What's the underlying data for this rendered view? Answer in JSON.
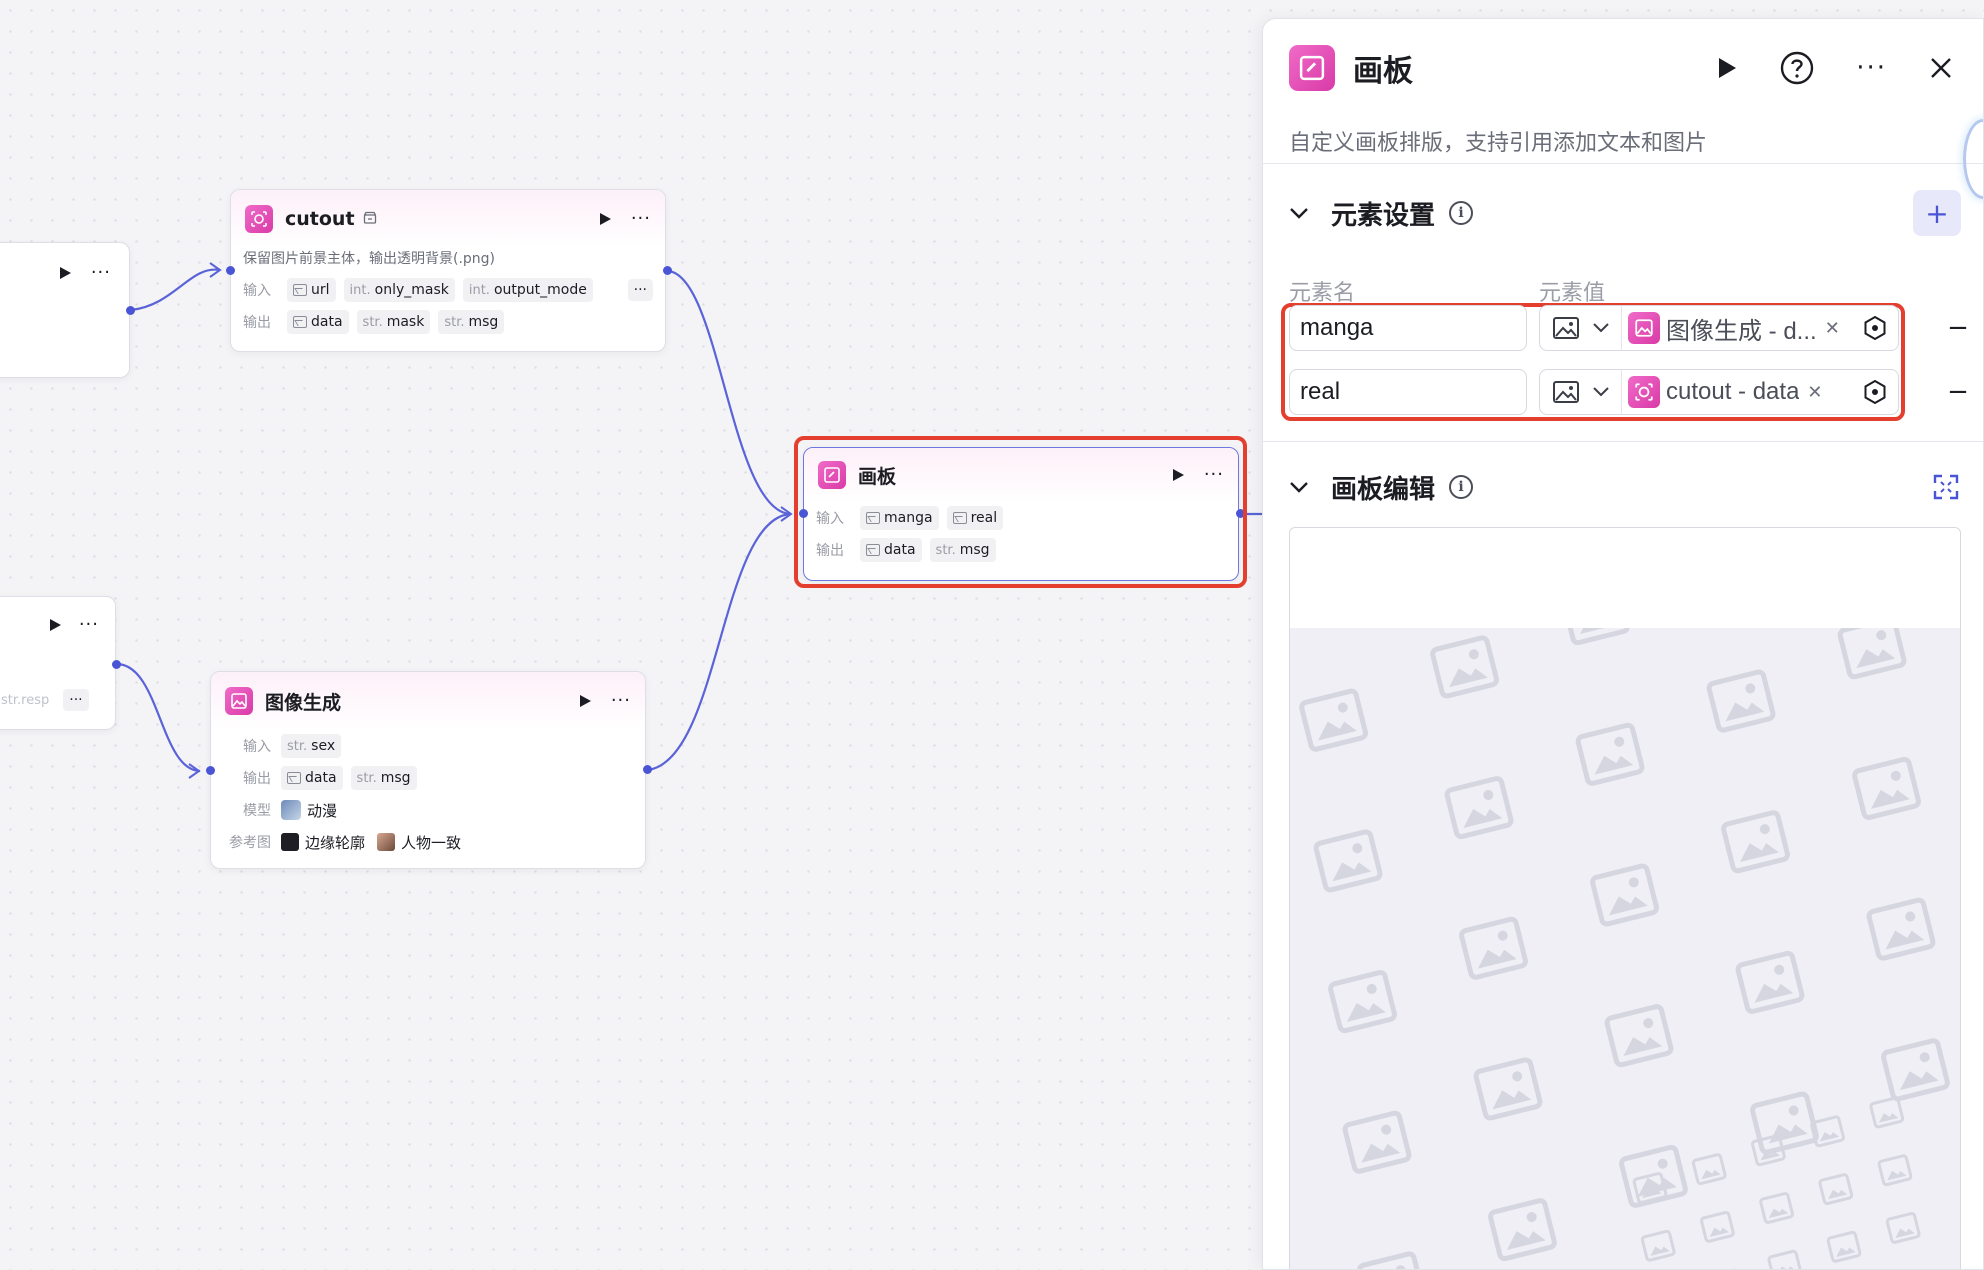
{
  "nodes": {
    "left_top": {
      "more": "···"
    },
    "left_bottom": {
      "more": "···",
      "partial_tag": "str.resp",
      "mini_more": "···"
    },
    "cutout": {
      "title": "cutout",
      "desc": "保留图片前景主体，输出透明背景(.png)",
      "input_label": "输入",
      "output_label": "输出",
      "inputs": [
        {
          "type": "",
          "name": "url",
          "icon": "image-icon"
        },
        {
          "type": "int.",
          "name": "only_mask"
        },
        {
          "type": "int.",
          "name": "output_mode"
        }
      ],
      "outputs": [
        {
          "type": "",
          "name": "data",
          "icon": "image-icon"
        },
        {
          "type": "str.",
          "name": "mask"
        },
        {
          "type": "str.",
          "name": "msg"
        }
      ],
      "more": "···",
      "mini_more": "···"
    },
    "canvas": {
      "title": "画板",
      "input_label": "输入",
      "output_label": "输出",
      "inputs": [
        {
          "type": "",
          "name": "manga",
          "icon": "image-icon"
        },
        {
          "type": "",
          "name": "real",
          "icon": "image-icon"
        }
      ],
      "outputs": [
        {
          "type": "",
          "name": "data",
          "icon": "image-icon"
        },
        {
          "type": "str.",
          "name": "msg"
        }
      ],
      "more": "···"
    },
    "image_gen": {
      "title": "图像生成",
      "input_label": "输入",
      "output_label": "输出",
      "model_label": "模型",
      "ref_label": "参考图",
      "inputs": [
        {
          "type": "str.",
          "name": "sex"
        }
      ],
      "outputs": [
        {
          "type": "",
          "name": "data",
          "icon": "image-icon"
        },
        {
          "type": "str.",
          "name": "msg"
        }
      ],
      "model": "动漫",
      "refs": [
        "边缘轮廓",
        "人物一致"
      ],
      "more": "···"
    }
  },
  "panel": {
    "title": "画板",
    "description": "自定义画板排版，支持引用添加文本和图片",
    "more": "···",
    "elements_section": {
      "title": "元素设置",
      "col_name": "元素名",
      "col_value": "元素值",
      "add": "+",
      "rows": [
        {
          "name": "manga",
          "ref": "图像生成 - data",
          "ref_display": "图像生成 - d...",
          "remove": "−"
        },
        {
          "name": "real",
          "ref": "cutout - data",
          "ref_display": "cutout - data",
          "remove": "−"
        }
      ]
    },
    "editor_section": {
      "title": "画板编辑"
    }
  },
  "colors": {
    "accent": "#4a55d6",
    "node_icon": "#e04fb5",
    "highlight": "#e43f2e",
    "canvas_bg": "#f4f4f6"
  }
}
